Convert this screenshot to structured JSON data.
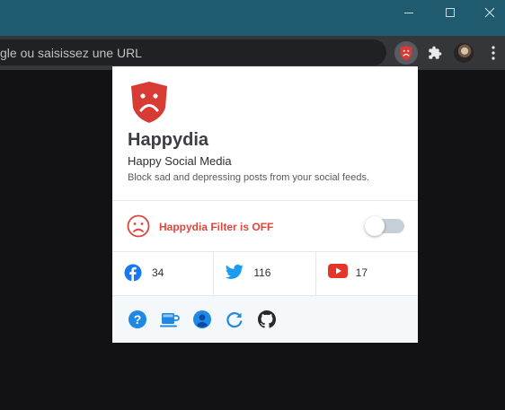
{
  "browser": {
    "address_bar_text": "gle ou saisissez une URL",
    "window_controls": [
      "minimize-icon",
      "maximize-icon",
      "close-icon"
    ],
    "toolbar_icons": [
      "happydia-extension-icon",
      "puzzle-icon",
      "avatar",
      "more-vert-icon"
    ]
  },
  "popup": {
    "app_name": "Happydia",
    "tagline": "Happy Social Media",
    "description": "Block sad and depressing posts from your social feeds.",
    "filter": {
      "label": "Happydia Filter is OFF",
      "enabled": false,
      "icon": "sad-face-icon"
    },
    "stats": [
      {
        "network": "Facebook",
        "icon": "facebook-icon",
        "count": "34"
      },
      {
        "network": "Twitter",
        "icon": "twitter-icon",
        "count": "116"
      },
      {
        "network": "YouTube",
        "icon": "youtube-icon",
        "count": "17"
      }
    ],
    "footer_icons": [
      "help-icon",
      "coffee-icon",
      "user-icon",
      "refresh-icon",
      "github-icon"
    ]
  },
  "colors": {
    "accent_red": "#e0453a",
    "brand_red": "#d83a34",
    "icon_blue": "#1877f2",
    "twitter_blue": "#1d9bf0",
    "youtube_red": "#e5352b",
    "titlebar": "#1f5a6e"
  }
}
